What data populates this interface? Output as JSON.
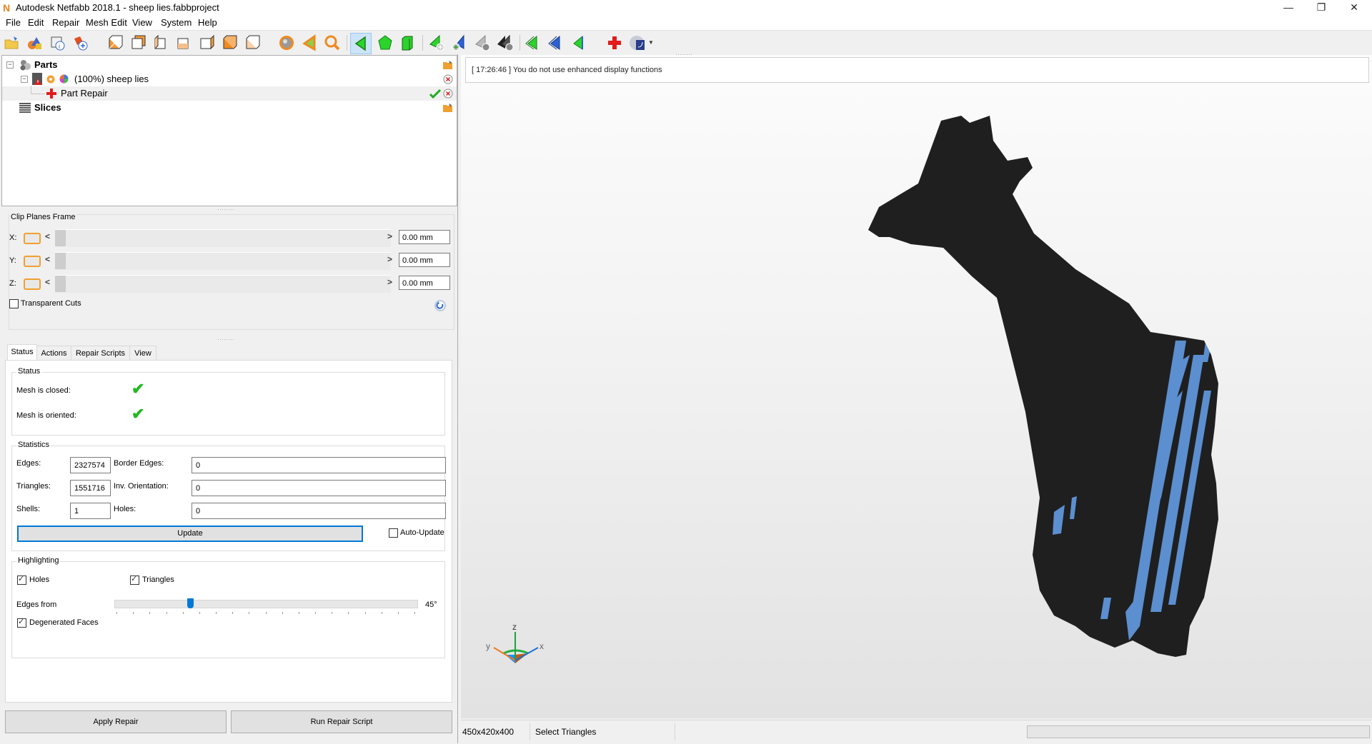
{
  "window": {
    "title": "Autodesk Netfabb 2018.1 - sheep lies.fabbproject",
    "app_icon": "N",
    "controls": {
      "minimize": "—",
      "restore": "❐",
      "close": "✕"
    }
  },
  "menu": [
    "File",
    "Edit",
    "Repair",
    "Mesh Edit",
    "View",
    "System",
    "Help"
  ],
  "toolbar": {
    "groups": [
      [
        "open-project-icon",
        "add-part-icon",
        "part-info-icon",
        "new-part-icon"
      ],
      [
        "view-front-icon",
        "view-back-icon",
        "view-left-icon",
        "view-right-icon",
        "view-top-icon",
        "view-bottom-icon",
        "view-iso-icon"
      ],
      [
        "shading-sphere-icon",
        "select-triangle-orange-icon",
        "zoom-icon"
      ],
      [
        "select-triangle-icon",
        "select-surface-icon",
        "select-shell-icon"
      ],
      [
        "add-triangle-icon",
        "add-triangle-blue-icon",
        "remove-triangle-icon",
        "remove-all-icon"
      ],
      [
        "flip-triangle-green-icon",
        "flip-triangle-blue-icon",
        "invert-selection-icon"
      ],
      [
        "repair-cross-icon",
        "view-options-icon"
      ]
    ],
    "active_tool": "select-triangle-icon"
  },
  "tree": {
    "items": [
      {
        "label": "Parts",
        "bold": true,
        "level": 0
      },
      {
        "label": "(100%) sheep lies",
        "bold": false,
        "level": 1
      },
      {
        "label": "Part Repair",
        "bold": false,
        "level": 2,
        "selected": true
      },
      {
        "label": "Slices",
        "bold": true,
        "level": 0
      }
    ]
  },
  "clip_planes": {
    "title": "Clip Planes Frame",
    "axes": [
      {
        "label": "X:",
        "value": "0.00 mm",
        "fraction": 0.0
      },
      {
        "label": "Y:",
        "value": "0.00 mm",
        "fraction": 0.0
      },
      {
        "label": "Z:",
        "value": "0.00 mm",
        "fraction": 0.0
      }
    ],
    "transparent_cuts_label": "Transparent Cuts",
    "transparent_cuts_checked": false,
    "arrow_left": "<",
    "arrow_right": ">"
  },
  "tabs": [
    {
      "label": "Status",
      "active": true
    },
    {
      "label": "Actions",
      "active": false
    },
    {
      "label": "Repair Scripts",
      "active": false
    },
    {
      "label": "View",
      "active": false
    }
  ],
  "status_group": {
    "title": "Status",
    "rows": [
      {
        "label": "Mesh is closed:",
        "ok": true
      },
      {
        "label": "Mesh is oriented:",
        "ok": true
      }
    ]
  },
  "statistics": {
    "title": "Statistics",
    "edges_label": "Edges:",
    "edges": "2327574",
    "triangles_label": "Triangles:",
    "triangles": "1551716",
    "shells_label": "Shells:",
    "shells": "1",
    "border_edges_label": "Border Edges:",
    "border_edges": "0",
    "inv_orientation_label": "Inv. Orientation:",
    "inv_orientation": "0",
    "holes_label": "Holes:",
    "holes": "0",
    "update_label": "Update",
    "auto_update_label": "Auto-Update",
    "auto_update_checked": false
  },
  "highlighting": {
    "title": "Highlighting",
    "holes_label": "Holes",
    "holes_checked": true,
    "triangles_label": "Triangles",
    "triangles_checked": true,
    "edges_from_label": "Edges from",
    "edges_from_value": "45°",
    "edges_from_fraction": 0.25,
    "degenerated_label": "Degenerated Faces",
    "degenerated_checked": true
  },
  "buttons": {
    "apply_repair": "Apply Repair",
    "run_repair_script": "Run Repair Script"
  },
  "viewport": {
    "log_message": "[ 17:26:46 ] You do not use enhanced display functions",
    "axis_labels": {
      "x": "x",
      "y": "y",
      "z": "z"
    },
    "model_color": "#1f1f1f",
    "highlight_color": "#5b8fd0"
  },
  "statusbar": {
    "dimensions": "450x420x400",
    "mode": "Select Triangles",
    "progress_fraction": 0
  }
}
